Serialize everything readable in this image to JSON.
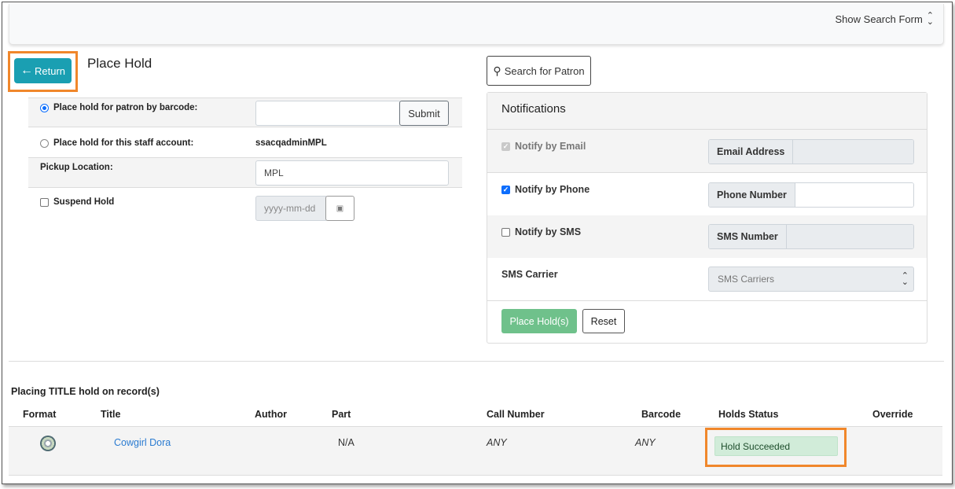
{
  "topbar": {
    "show_search_form": "Show Search Form"
  },
  "header": {
    "return_label": "Return",
    "page_title": "Place Hold"
  },
  "patron_form": {
    "by_barcode_label": "Place hold for patron by barcode:",
    "barcode_value": "",
    "submit_label": "Submit",
    "staff_account_label": "Place hold for this staff account:",
    "staff_account_value": "ssacqadminMPL",
    "pickup_location_label": "Pickup Location:",
    "pickup_location_value": "MPL",
    "suspend_hold_label": "Suspend Hold",
    "date_placeholder": "yyyy-mm-dd"
  },
  "search_patron_label": "Search for Patron",
  "notifications": {
    "title": "Notifications",
    "email": {
      "label": "Notify by Email",
      "addon": "Email Address",
      "checked": true,
      "disabled": true
    },
    "phone": {
      "label": "Notify by Phone",
      "addon": "Phone Number",
      "checked": true
    },
    "sms": {
      "label": "Notify by SMS",
      "addon": "SMS Number",
      "checked": false
    },
    "sms_carrier": {
      "label": "SMS Carrier",
      "select_value": "SMS Carriers"
    },
    "place_holds_label": "Place Hold(s)",
    "reset_label": "Reset"
  },
  "records": {
    "title": "Placing TITLE hold on record(s)",
    "columns": [
      "Format",
      "Title",
      "Author",
      "Part",
      "Call Number",
      "Barcode",
      "Holds Status",
      "Override"
    ],
    "rows": [
      {
        "title": "Cowgirl Dora",
        "author": "",
        "part": "N/A",
        "call_number": "ANY",
        "barcode": "ANY",
        "holds_status": "Hold Succeeded",
        "override": ""
      }
    ]
  },
  "colors": {
    "return_button": "#1a9fb2",
    "place_hold_button": "#6fc18b",
    "highlight_box": "#f0872b",
    "status_success_bg": "#d1ecd9",
    "link": "#2a7bd1"
  }
}
